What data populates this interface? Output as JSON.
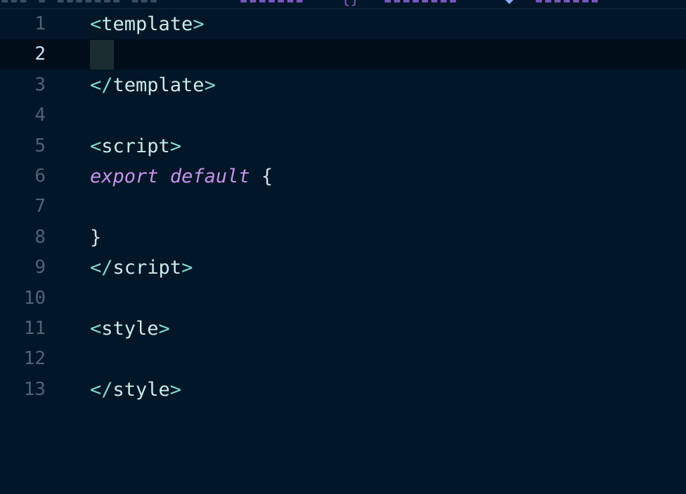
{
  "lines": [
    {
      "number": "1",
      "parts": [
        {
          "t": "<",
          "c": "tag"
        },
        {
          "t": "template",
          "c": "tagname"
        },
        {
          "t": ">",
          "c": "tag"
        }
      ]
    },
    {
      "number": "2",
      "parts": [],
      "current": true
    },
    {
      "number": "3",
      "parts": [
        {
          "t": "</",
          "c": "tag"
        },
        {
          "t": "template",
          "c": "tagname"
        },
        {
          "t": ">",
          "c": "tag"
        }
      ]
    },
    {
      "number": "4",
      "parts": []
    },
    {
      "number": "5",
      "parts": [
        {
          "t": "<",
          "c": "tag"
        },
        {
          "t": "script",
          "c": "tagname"
        },
        {
          "t": ">",
          "c": "tag"
        }
      ]
    },
    {
      "number": "6",
      "parts": [
        {
          "t": "export",
          "c": "kw"
        },
        {
          "t": " ",
          "c": "punct"
        },
        {
          "t": "default",
          "c": "kw"
        },
        {
          "t": " {",
          "c": "punct"
        }
      ]
    },
    {
      "number": "7",
      "parts": []
    },
    {
      "number": "8",
      "parts": [
        {
          "t": "}",
          "c": "punct"
        }
      ]
    },
    {
      "number": "9",
      "parts": [
        {
          "t": "</",
          "c": "tag"
        },
        {
          "t": "script",
          "c": "tagname"
        },
        {
          "t": ">",
          "c": "tag"
        }
      ]
    },
    {
      "number": "10",
      "parts": []
    },
    {
      "number": "11",
      "parts": [
        {
          "t": "<",
          "c": "tag"
        },
        {
          "t": "style",
          "c": "tagname"
        },
        {
          "t": ">",
          "c": "tag"
        }
      ]
    },
    {
      "number": "12",
      "parts": []
    },
    {
      "number": "13",
      "parts": [
        {
          "t": "</",
          "c": "tag"
        },
        {
          "t": "style",
          "c": "tagname"
        },
        {
          "t": ">",
          "c": "tag"
        }
      ]
    }
  ],
  "colors": {
    "background": "#011627",
    "current_line": "#010e1a",
    "tag_bracket": "#7fdbca",
    "tag_name": "#caece6",
    "keyword": "#c792ea",
    "line_number": "#4b6479",
    "line_number_active": "#c5e4fd"
  }
}
